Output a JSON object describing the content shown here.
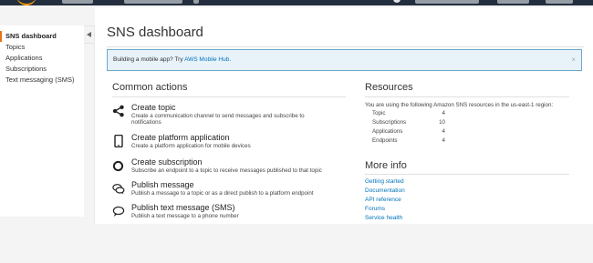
{
  "sidebar": {
    "items": [
      {
        "label": "SNS dashboard",
        "active": true
      },
      {
        "label": "Topics"
      },
      {
        "label": "Applications"
      },
      {
        "label": "Subscriptions"
      },
      {
        "label": "Text messaging (SMS)"
      }
    ]
  },
  "main": {
    "title": "SNS dashboard",
    "alert": {
      "text": "Building a mobile app? Try ",
      "link": "AWS Mobile Hub",
      "suffix": ".",
      "close": "×"
    },
    "common_actions": {
      "title": "Common actions",
      "items": [
        {
          "title": "Create topic",
          "desc": "Create a communication channel to send messages and subscribe to notifications",
          "icon": "share-icon"
        },
        {
          "title": "Create platform application",
          "desc": "Create a platform application for mobile devices",
          "icon": "mobile-device-icon"
        },
        {
          "title": "Create subscription",
          "desc": "Subscribe an endpoint to a topic to receive messages published to that topic",
          "icon": "circle-icon"
        },
        {
          "title": "Publish message",
          "desc": "Publish a message to a topic or as a direct publish to a platform endpoint",
          "icon": "chat-bubbles-icon"
        },
        {
          "title": "Publish text message (SMS)",
          "desc": "Publish a text message to a phone number",
          "icon": "speech-bubble-icon"
        }
      ]
    },
    "resources": {
      "title": "Resources",
      "intro": "You are using the following Amazon SNS resources in the us-east-1 region:",
      "rows": [
        {
          "label": "Topic",
          "count": "4"
        },
        {
          "label": "Subscriptions",
          "count": "10"
        },
        {
          "label": "Applications",
          "count": "4"
        },
        {
          "label": "Endpoints",
          "count": "4"
        }
      ]
    },
    "more_info": {
      "title": "More info",
      "links": [
        "Getting started",
        "Documentation",
        "API reference",
        "Forums",
        "Service health"
      ]
    }
  },
  "colors": {
    "topbar": "#232f3e",
    "accent": "#ec7211",
    "link": "#0073bb",
    "alert_bg": "#e7f2f9",
    "alert_border": "#6da7cc"
  }
}
